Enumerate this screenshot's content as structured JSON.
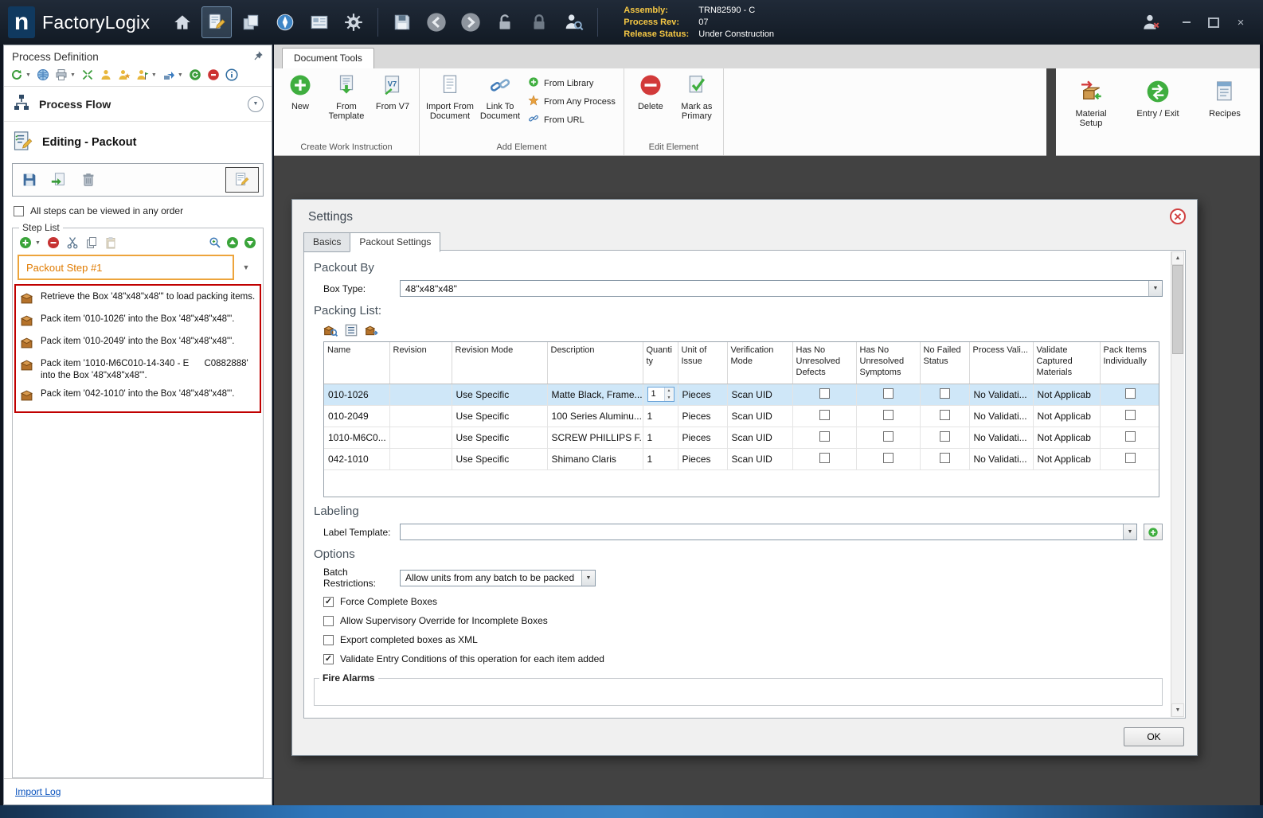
{
  "titlebar": {
    "app_name": "FactoryLogix",
    "info": {
      "assembly_label": "Assembly:",
      "assembly_value": "TRN82590 - C",
      "process_rev_label": "Process Rev:",
      "process_rev_value": "07",
      "release_status_label": "Release Status:",
      "release_status_value": "Under Construction"
    }
  },
  "left_panel": {
    "title": "Process Definition",
    "process_flow_label": "Process Flow",
    "editing_label": "Editing - Packout",
    "order_checkbox": {
      "label": "All steps can be viewed in any order",
      "checked": false
    },
    "step_list": {
      "title": "Step List",
      "selected_step": "Packout Step #1",
      "items": [
        {
          "text": "Retrieve the Box '48\"x48\"x48\"' to load packing items."
        },
        {
          "text": "Pack item '010-1026' into the Box '48\"x48\"x48\"'."
        },
        {
          "text": "Pack item '010-2049' into the Box '48\"x48\"x48\"'."
        },
        {
          "text": "Pack item '1010-M6C010-14-340 - E      C0882888' into the Box '48\"x48\"x48\"'."
        },
        {
          "text": "Pack item '042-1010' into the Box '48\"x48\"x48\"'."
        }
      ]
    },
    "import_log_link": "Import Log"
  },
  "ribbon": {
    "tab_label": "Document Tools",
    "create_group": {
      "label": "Create Work Instruction",
      "new": "New",
      "from_template": "From Template",
      "from_v7": "From V7"
    },
    "add_group": {
      "label": "Add Element",
      "import_doc": "Import From Document",
      "link_doc": "Link To Document",
      "from_library": "From Library",
      "from_any_process": "From Any Process",
      "from_url": "From URL"
    },
    "edit_group": {
      "label": "Edit Element",
      "delete": "Delete",
      "mark_primary": "Mark as Primary"
    },
    "right_group": {
      "material_setup": "Material Setup",
      "entry_exit": "Entry / Exit",
      "recipes": "Recipes"
    }
  },
  "dialog": {
    "title": "Settings",
    "tabs": {
      "basics": "Basics",
      "packout": "Packout Settings"
    },
    "packout_by": {
      "heading": "Packout By",
      "box_type_label": "Box Type:",
      "box_type_value": "48\"x48\"x48\""
    },
    "packing_list": {
      "heading": "Packing List:",
      "columns": [
        "Name",
        "Revision",
        "Revision Mode",
        "Description",
        "Quantity",
        "Unit of Issue",
        "Verification Mode",
        "Has No Unresolved Defects",
        "Has No Unresolved Symptoms",
        "No Failed Status",
        "Process Vali...",
        "Validate Captured Materials",
        "Pack Items Individually"
      ],
      "rows": [
        {
          "name": "010-1026",
          "revision": "",
          "revision_mode": "Use Specific",
          "description": "Matte Black, Frame...",
          "quantity": "1",
          "unit_of_issue": "Pieces",
          "verification_mode": "Scan UID",
          "process_validation": "No Validati...",
          "validate_materials": "Not Applicab",
          "selected": true
        },
        {
          "name": "010-2049",
          "revision": "",
          "revision_mode": "Use Specific",
          "description": "100 Series Aluminu...",
          "quantity": "1",
          "unit_of_issue": "Pieces",
          "verification_mode": "Scan UID",
          "process_validation": "No Validati...",
          "validate_materials": "Not Applicab",
          "selected": false
        },
        {
          "name": "1010-M6C0...",
          "revision": "",
          "revision_mode": "Use Specific",
          "description": "SCREW PHILLIPS F...",
          "quantity": "1",
          "unit_of_issue": "Pieces",
          "verification_mode": "Scan UID",
          "process_validation": "No Validati...",
          "validate_materials": "Not Applicab",
          "selected": false
        },
        {
          "name": "042-1010",
          "revision": "",
          "revision_mode": "Use Specific",
          "description": "Shimano Claris",
          "quantity": "1",
          "unit_of_issue": "Pieces",
          "verification_mode": "Scan UID",
          "process_validation": "No Validati...",
          "validate_materials": "Not Applicab",
          "selected": false
        }
      ]
    },
    "labeling": {
      "heading": "Labeling",
      "label_template_label": "Label Template:",
      "label_template_value": ""
    },
    "options": {
      "heading": "Options",
      "batch_label": "Batch Restrictions:",
      "batch_value": "Allow units from any batch to be packed",
      "checkboxes": [
        {
          "label": "Force Complete Boxes",
          "checked": true
        },
        {
          "label": "Allow Supervisory Override for Incomplete Boxes",
          "checked": false
        },
        {
          "label": "Export completed boxes as XML",
          "checked": false
        },
        {
          "label": "Validate Entry Conditions of this operation for each item added",
          "checked": true
        }
      ]
    },
    "fire_alarms_heading": "Fire Alarms",
    "ok_label": "OK"
  }
}
